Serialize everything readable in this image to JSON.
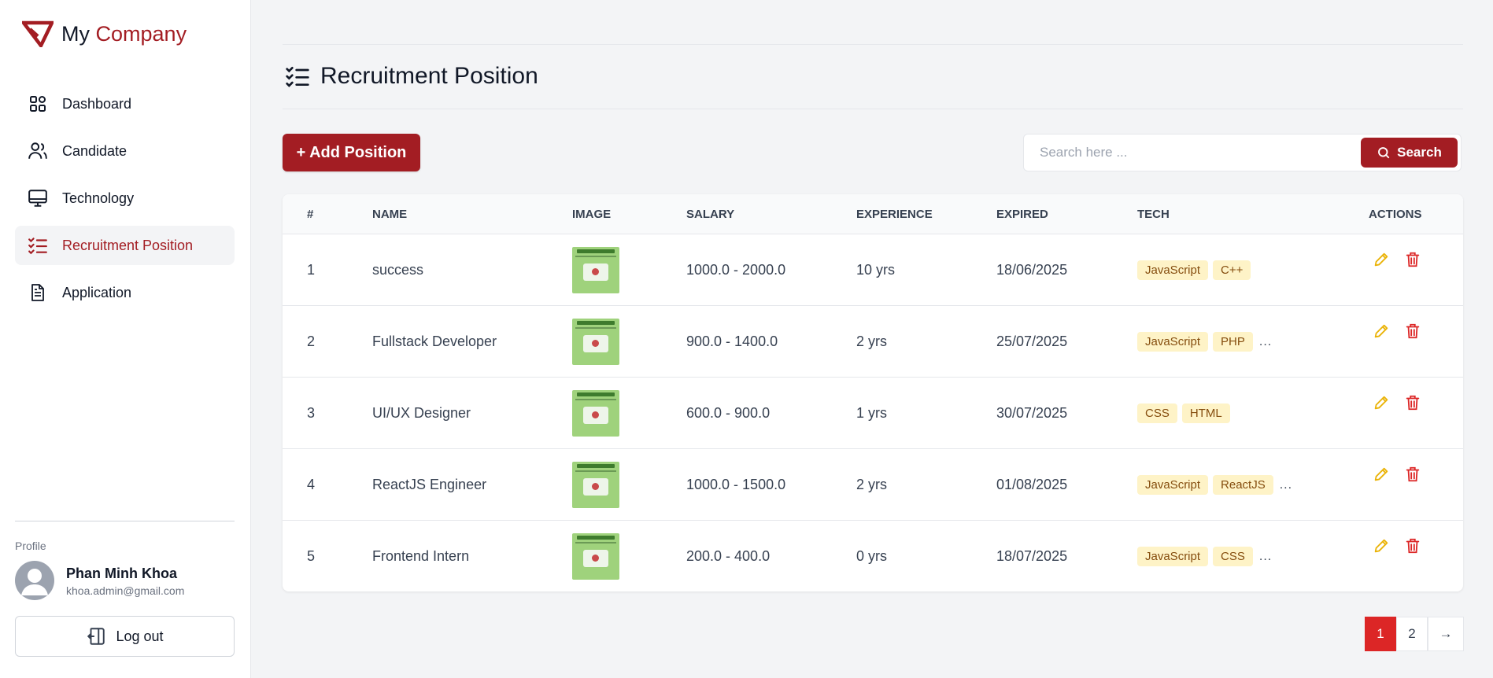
{
  "brand": {
    "name_part1": "My",
    "name_part2": "Company",
    "accent_color": "#a31d23"
  },
  "sidebar": {
    "items": [
      {
        "label": "Dashboard",
        "icon": "dashboard-grid-icon"
      },
      {
        "label": "Candidate",
        "icon": "users-icon"
      },
      {
        "label": "Technology",
        "icon": "monitor-icon"
      },
      {
        "label": "Recruitment Position",
        "icon": "list-check-icon",
        "active": true
      },
      {
        "label": "Application",
        "icon": "document-icon"
      }
    ],
    "profile_label": "Profile",
    "profile_name": "Phan Minh Khoa",
    "profile_email": "khoa.admin@gmail.com",
    "logout_label": "Log out"
  },
  "page": {
    "title": "Recruitment Position"
  },
  "toolbar": {
    "add_label": "+ Add Position",
    "search_placeholder": "Search here ...",
    "search_label": "Search"
  },
  "table": {
    "headers": [
      "#",
      "NAME",
      "IMAGE",
      "SALARY",
      "EXPERIENCE",
      "EXPIRED",
      "TECH",
      "ACTIONS"
    ],
    "rows": [
      {
        "idx": "1",
        "name": "success",
        "salary": "1000.0 - 2000.0",
        "experience": "10 yrs",
        "expired": "18/06/2025",
        "tags": [
          "JavaScript",
          "C++"
        ],
        "more": ""
      },
      {
        "idx": "2",
        "name": "Fullstack Developer",
        "salary": "900.0 - 1400.0",
        "experience": "2 yrs",
        "expired": "25/07/2025",
        "tags": [
          "JavaScript",
          "PHP"
        ],
        "more": "..."
      },
      {
        "idx": "3",
        "name": "UI/UX Designer",
        "salary": "600.0 - 900.0",
        "experience": "1 yrs",
        "expired": "30/07/2025",
        "tags": [
          "CSS",
          "HTML"
        ],
        "more": ""
      },
      {
        "idx": "4",
        "name": "ReactJS Engineer",
        "salary": "1000.0 - 1500.0",
        "experience": "2 yrs",
        "expired": "01/08/2025",
        "tags": [
          "JavaScript",
          "ReactJS"
        ],
        "more": "..."
      },
      {
        "idx": "5",
        "name": "Frontend Intern",
        "salary": "200.0 - 400.0",
        "experience": "0 yrs",
        "expired": "18/07/2025",
        "tags": [
          "JavaScript",
          "CSS"
        ],
        "more": "..."
      }
    ]
  },
  "pagination": {
    "pages": [
      "1",
      "2"
    ],
    "current": "1",
    "next_label": "→"
  },
  "colors": {
    "tag_bg": "#fef3c7",
    "tag_text": "#854d0e",
    "edit": "#eab308",
    "delete": "#dc2626"
  }
}
